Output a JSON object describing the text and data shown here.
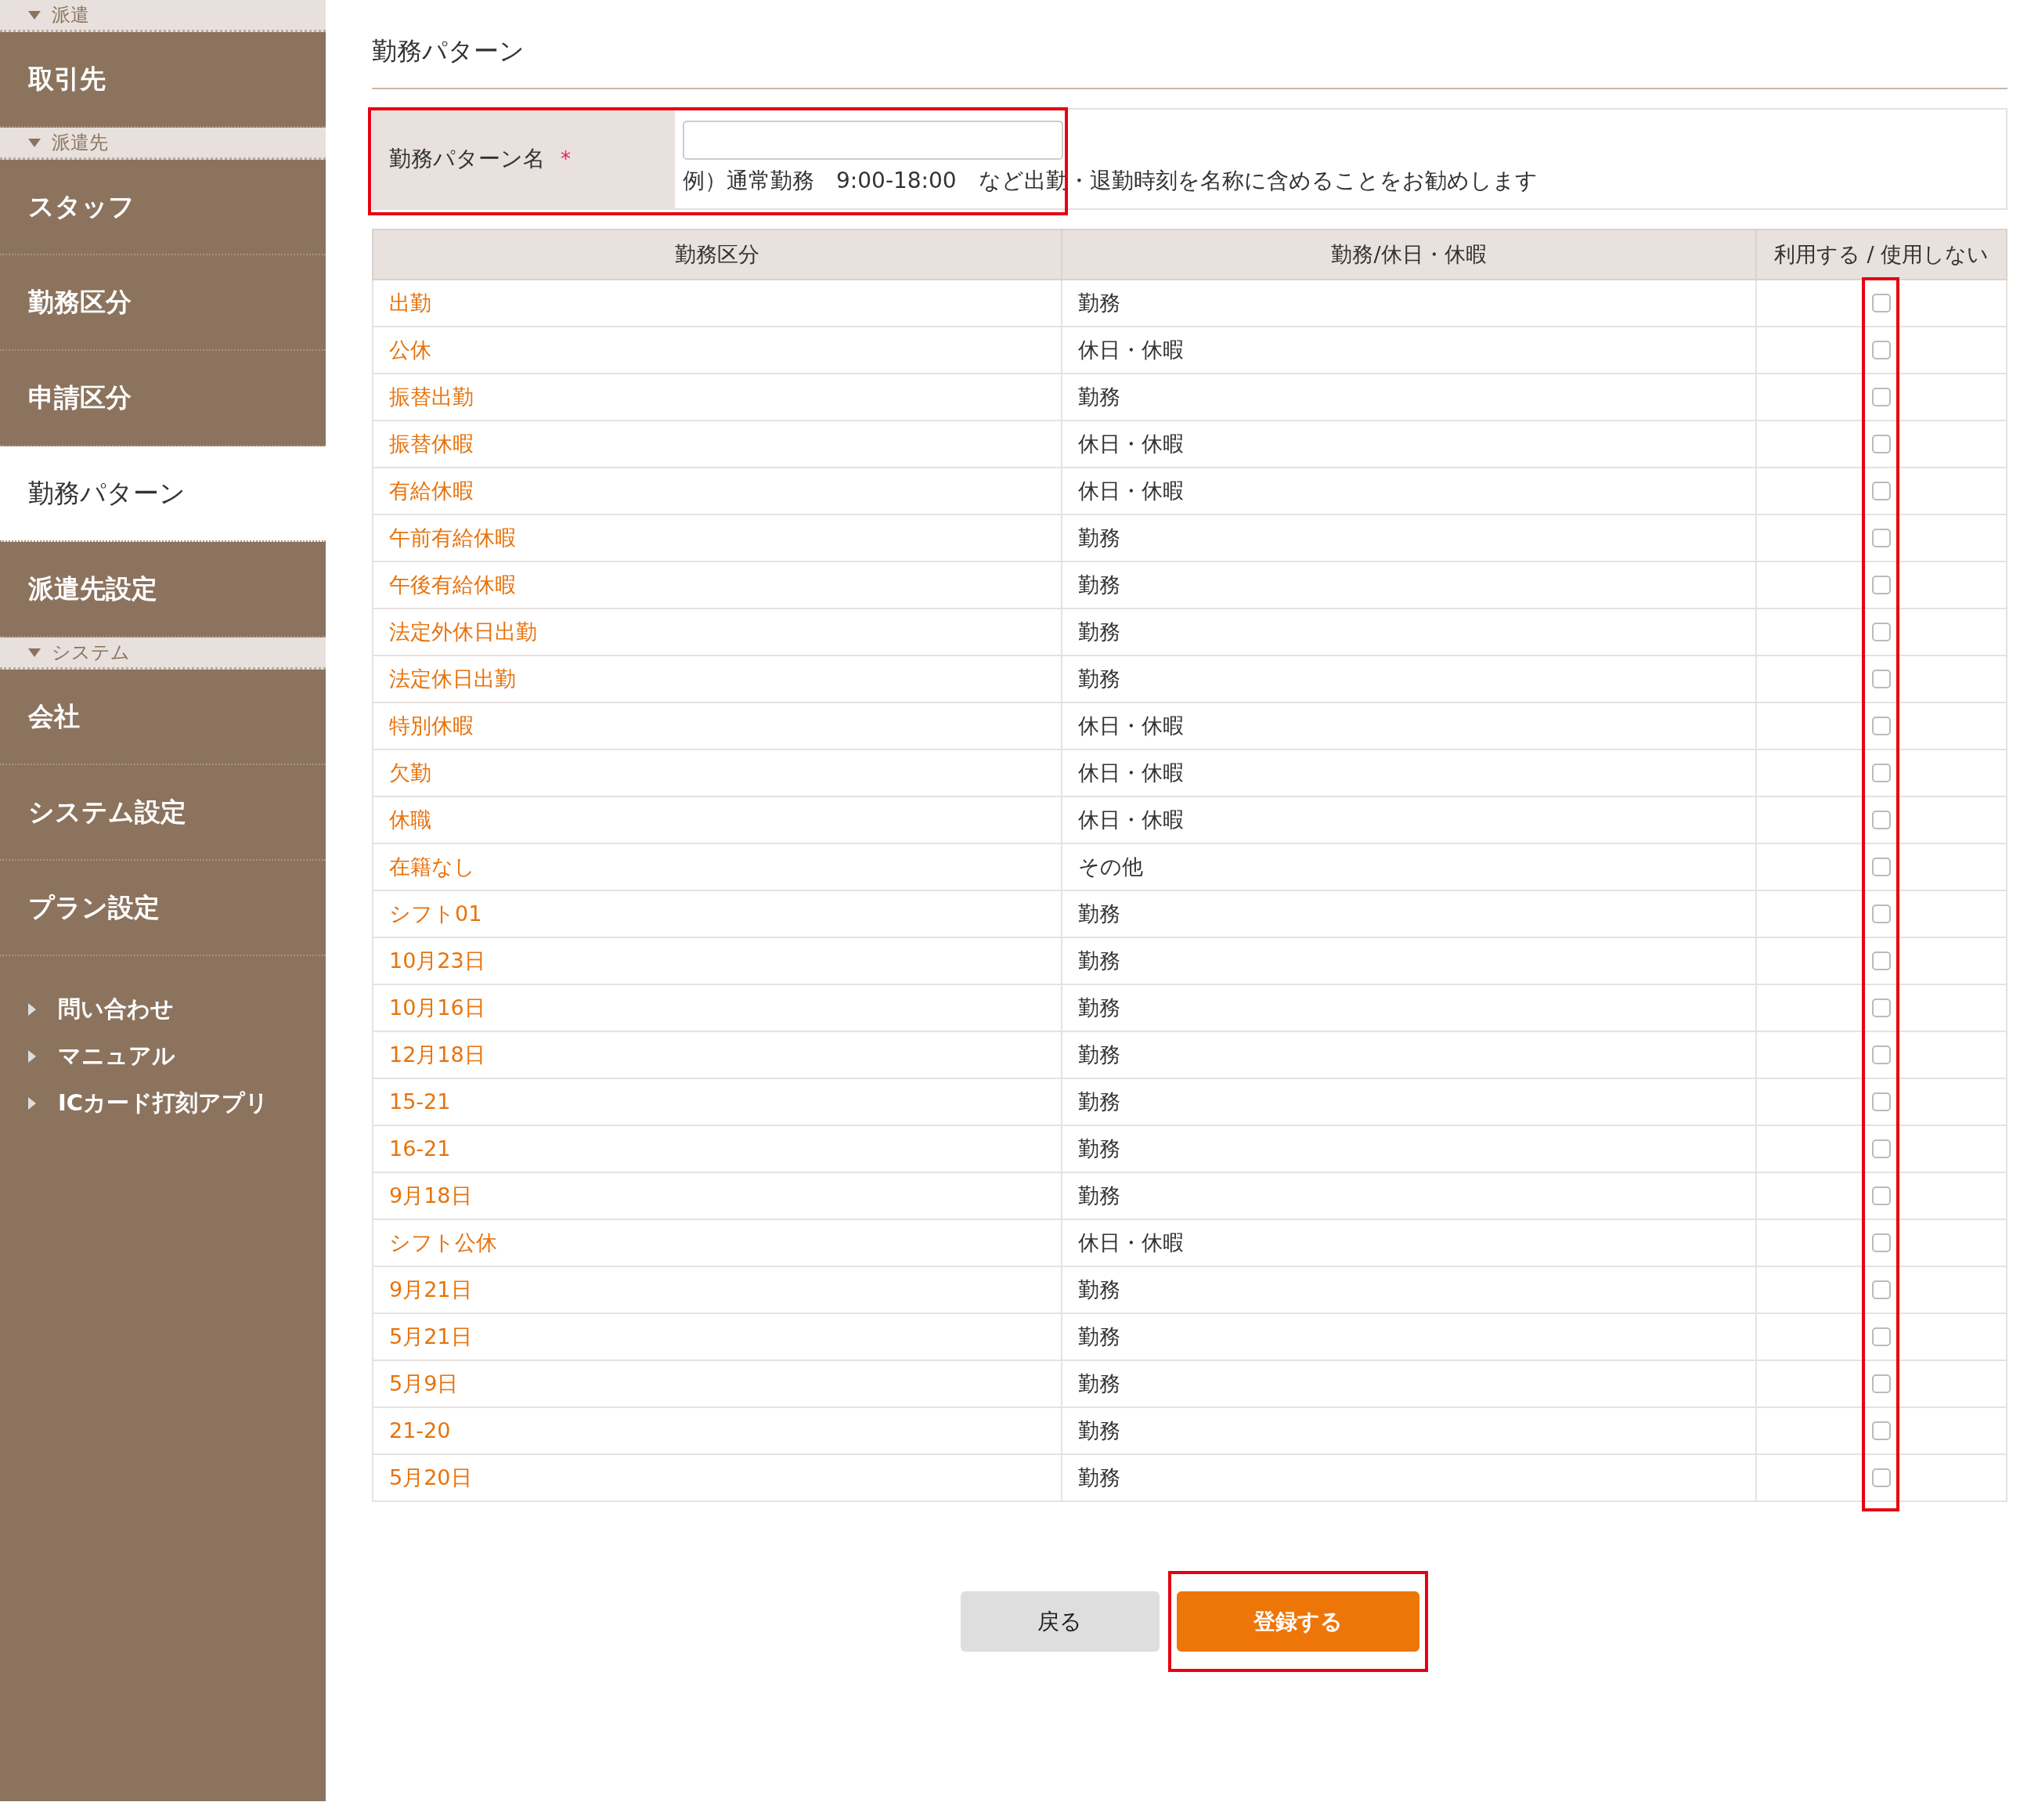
{
  "sidebar": {
    "sections": [
      {
        "title": "派遣",
        "expanded": true,
        "items": [
          {
            "label": "取引先",
            "selected": false
          }
        ]
      },
      {
        "title": "派遣先",
        "expanded": true,
        "items": [
          {
            "label": "スタッフ",
            "selected": false
          },
          {
            "label": "勤務区分",
            "selected": false
          },
          {
            "label": "申請区分",
            "selected": false
          },
          {
            "label": "勤務パターン",
            "selected": true
          },
          {
            "label": "派遣先設定",
            "selected": false
          }
        ]
      },
      {
        "title": "システム",
        "expanded": true,
        "items": [
          {
            "label": "会社",
            "selected": false
          },
          {
            "label": "システム設定",
            "selected": false
          },
          {
            "label": "プラン設定",
            "selected": false
          }
        ]
      }
    ],
    "links": [
      "問い合わせ",
      "マニュアル",
      "ICカード打刻アプリ"
    ]
  },
  "page": {
    "title": "勤務パターン"
  },
  "form": {
    "label": "勤務パターン名",
    "required_mark": "*",
    "hint": "例）通常勤務　9:00-18:00　など出勤・退勤時刻を名称に含めることをお勧めします",
    "highlighted": true
  },
  "table": {
    "columns": [
      "勤務区分",
      "勤務/休日・休暇",
      "利用する / 使用しない"
    ],
    "checkbox_column_highlighted": true,
    "rows": [
      {
        "name": "出勤",
        "type": "勤務",
        "checked": false
      },
      {
        "name": "公休",
        "type": "休日・休暇",
        "checked": false
      },
      {
        "name": "振替出勤",
        "type": "勤務",
        "checked": false
      },
      {
        "name": "振替休暇",
        "type": "休日・休暇",
        "checked": false
      },
      {
        "name": "有給休暇",
        "type": "休日・休暇",
        "checked": false
      },
      {
        "name": "午前有給休暇",
        "type": "勤務",
        "checked": false
      },
      {
        "name": "午後有給休暇",
        "type": "勤務",
        "checked": false
      },
      {
        "name": "法定外休日出勤",
        "type": "勤務",
        "checked": false
      },
      {
        "name": "法定休日出勤",
        "type": "勤務",
        "checked": false
      },
      {
        "name": "特別休暇",
        "type": "休日・休暇",
        "checked": false
      },
      {
        "name": "欠勤",
        "type": "休日・休暇",
        "checked": false
      },
      {
        "name": "休職",
        "type": "休日・休暇",
        "checked": false
      },
      {
        "name": "在籍なし",
        "type": "その他",
        "checked": false
      },
      {
        "name": "シフト01",
        "type": "勤務",
        "checked": false
      },
      {
        "name": "10月23日",
        "type": "勤務",
        "checked": false
      },
      {
        "name": "10月16日",
        "type": "勤務",
        "checked": false
      },
      {
        "name": "12月18日",
        "type": "勤務",
        "checked": false
      },
      {
        "name": "15-21",
        "type": "勤務",
        "checked": false
      },
      {
        "name": "16-21",
        "type": "勤務",
        "checked": false
      },
      {
        "name": "9月18日",
        "type": "勤務",
        "checked": false
      },
      {
        "name": "シフト公休",
        "type": "休日・休暇",
        "checked": false
      },
      {
        "name": "9月21日",
        "type": "勤務",
        "checked": false
      },
      {
        "name": "5月21日",
        "type": "勤務",
        "checked": false
      },
      {
        "name": "5月9日",
        "type": "勤務",
        "checked": false
      },
      {
        "name": "21-20",
        "type": "勤務",
        "checked": false
      },
      {
        "name": "5月20日",
        "type": "勤務",
        "checked": false
      }
    ]
  },
  "buttons": [
    {
      "label": "戻る",
      "kind": "secondary",
      "highlighted": false
    },
    {
      "label": "登録する",
      "kind": "primary",
      "highlighted": true
    }
  ]
}
